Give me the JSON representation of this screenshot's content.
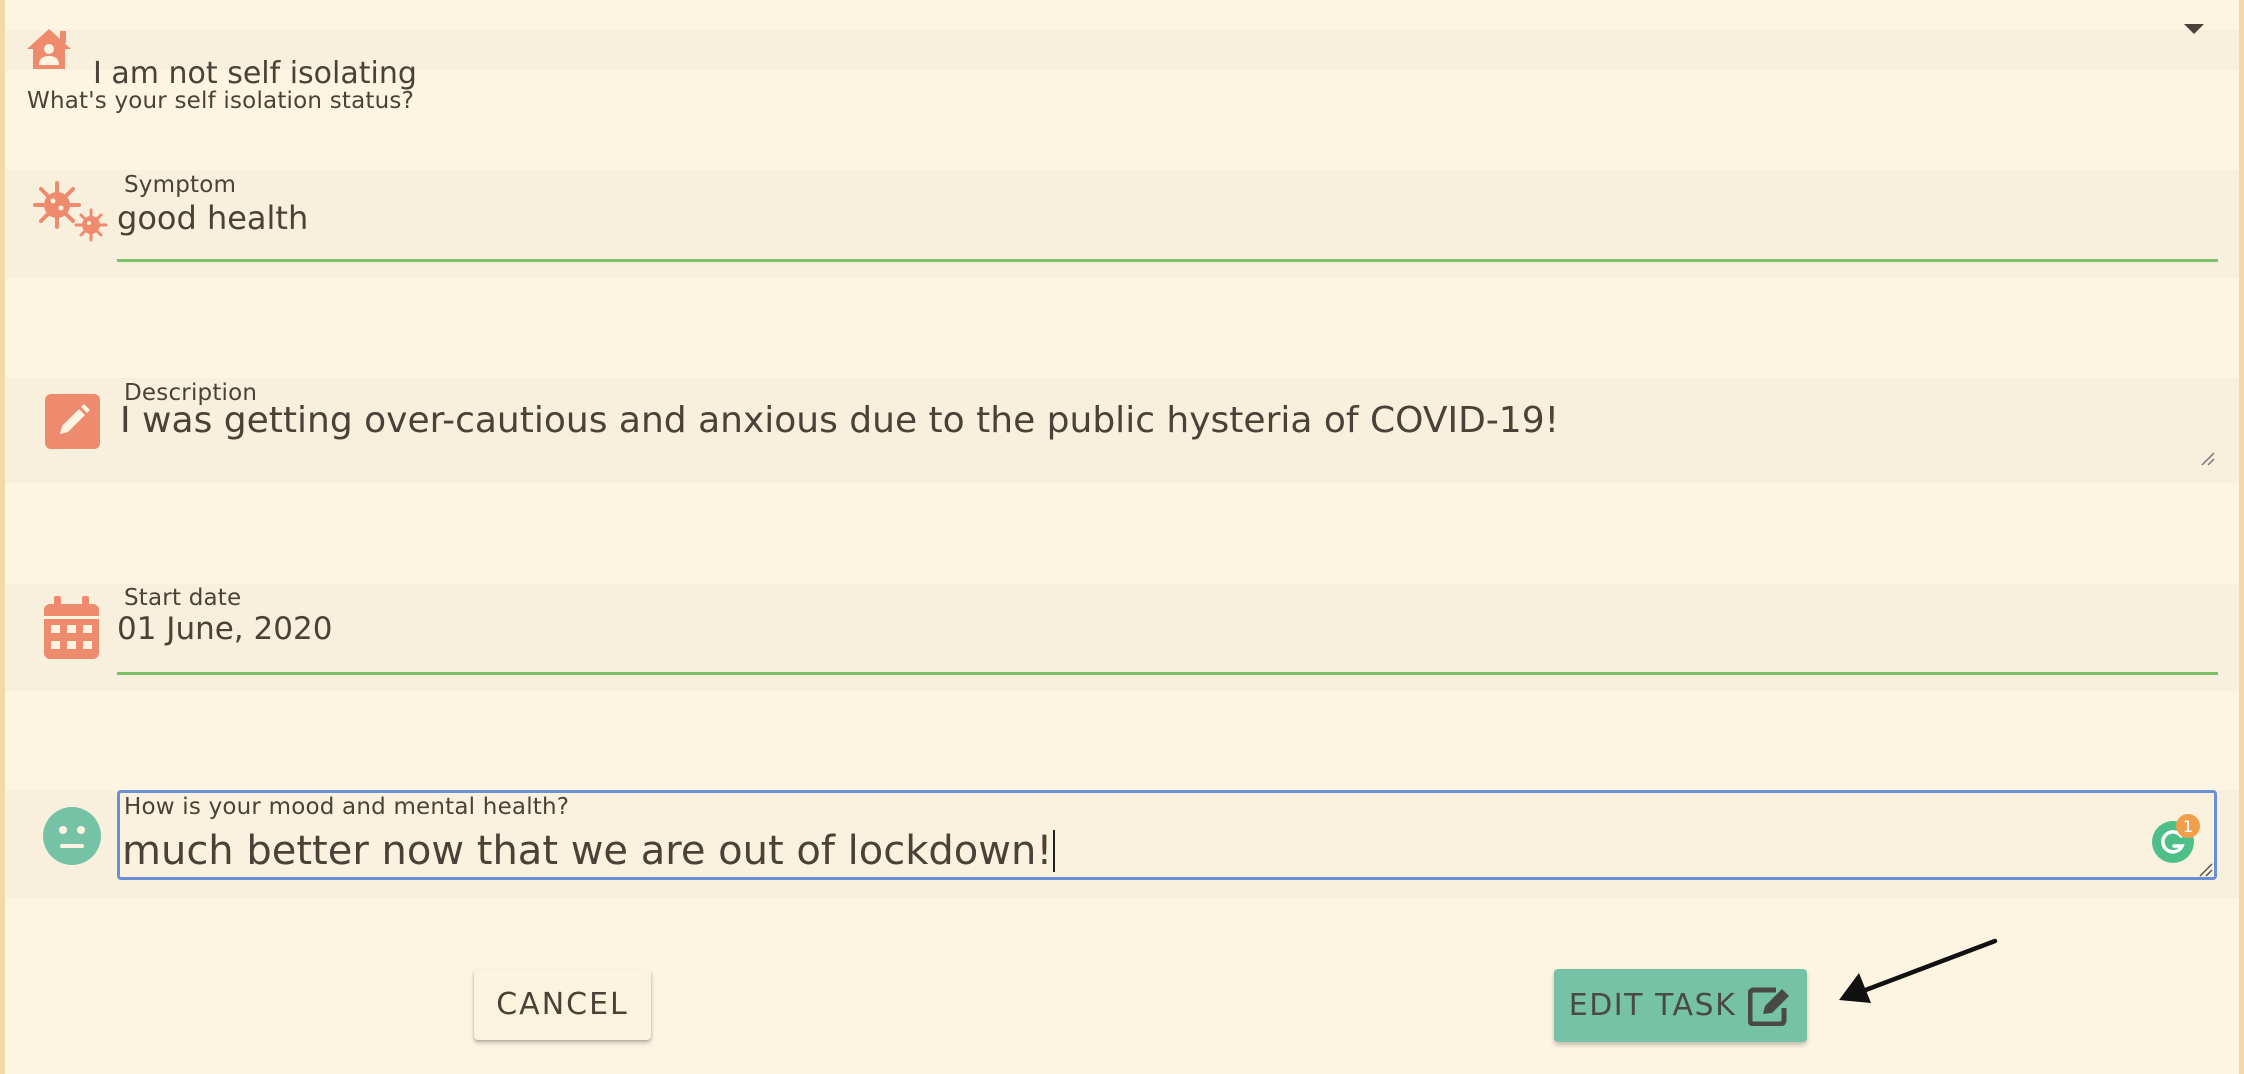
{
  "isolation": {
    "value": "I am not self isolating",
    "label": "What's your self isolation status?"
  },
  "symptom": {
    "label": "Symptom",
    "value": "good health"
  },
  "description": {
    "label": "Description",
    "value": "I was getting over-cautious and anxious due to the public hysteria of COVID-19!"
  },
  "start_date": {
    "label": "Start date",
    "value": "01 June, 2020"
  },
  "mood": {
    "label": "How is your mood and mental health?",
    "value": "much better now that we are out of lockdown!",
    "grammarly_count": "1"
  },
  "buttons": {
    "cancel": "CANCEL",
    "edit": "EDIT TASK"
  },
  "icons": {
    "isolation": "house-user-icon",
    "symptom": "virus-icon",
    "description": "edit-pen-icon",
    "start_date": "calendar-icon",
    "mood": "neutral-face-icon",
    "dropdown": "caret-down-icon",
    "edit_button": "edit-square-icon",
    "grammarly": "grammarly-icon",
    "annotation": "arrow-pointer-icon"
  },
  "colors": {
    "background": "#fdf5e2",
    "icon_accent": "#ee8a6e",
    "valid_underline": "#7cc06a",
    "focus_border": "#6a8fd6",
    "mood_icon": "#76c2a6",
    "edit_button": "#76c2a6"
  }
}
